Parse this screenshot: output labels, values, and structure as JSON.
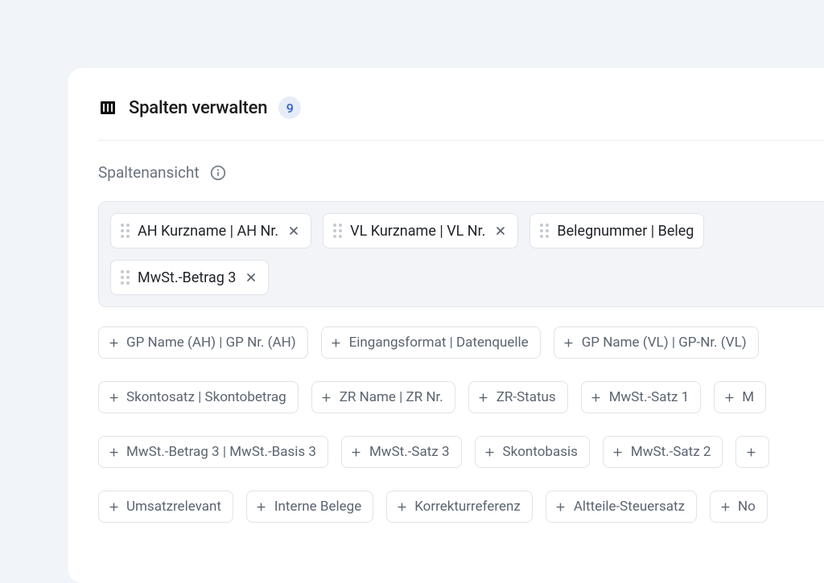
{
  "header": {
    "title": "Spalten verwalten",
    "count": "9"
  },
  "section": {
    "label": "Spaltenansicht"
  },
  "selected": [
    {
      "label": "AH Kurzname | AH Nr."
    },
    {
      "label": "VL Kurzname | VL Nr."
    },
    {
      "label": "Belegnummer | Beleg"
    },
    {
      "label": "MwSt.-Betrag 3"
    }
  ],
  "available": [
    {
      "label": "GP Name (AH) | GP Nr. (AH)"
    },
    {
      "label": "Eingangsformat | Datenquelle"
    },
    {
      "label": "GP Name (VL) | GP-Nr. (VL)"
    },
    {
      "label": "Skontosatz | Skontobetrag"
    },
    {
      "label": "ZR Name |  ZR Nr."
    },
    {
      "label": "ZR-Status"
    },
    {
      "label": "MwSt.-Satz 1"
    },
    {
      "label": "M"
    },
    {
      "label": "MwSt.-Betrag 3 | MwSt.-Basis 3"
    },
    {
      "label": "MwSt.-Satz 3"
    },
    {
      "label": "Skontobasis"
    },
    {
      "label": "MwSt.-Satz 2"
    },
    {
      "label": ""
    },
    {
      "label": "Umsatzrelevant"
    },
    {
      "label": "Interne Belege"
    },
    {
      "label": "Korrekturreferenz"
    },
    {
      "label": "Altteile-Steuersatz"
    },
    {
      "label": "No"
    }
  ]
}
